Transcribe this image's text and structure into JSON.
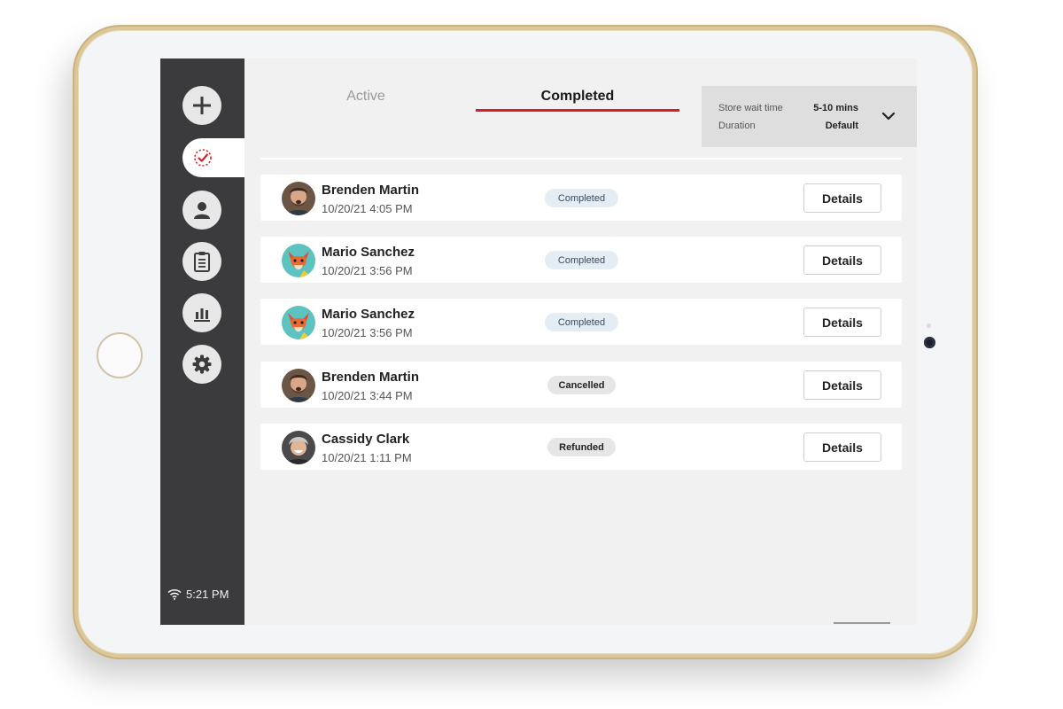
{
  "tabs": [
    {
      "label": "Active",
      "active": false
    },
    {
      "label": "Completed",
      "active": true
    }
  ],
  "wait_panel": {
    "store_wait_label": "Store wait time",
    "store_wait_value": "5-10 mins",
    "duration_label": "Duration",
    "duration_value": "Default"
  },
  "sidebar": {
    "items": [
      {
        "icon": "plus-icon",
        "active": false
      },
      {
        "icon": "check-timer-icon",
        "active": true
      },
      {
        "icon": "user-icon",
        "active": false
      },
      {
        "icon": "clipboard-icon",
        "active": false
      },
      {
        "icon": "bar-chart-icon",
        "active": false
      },
      {
        "icon": "gear-icon",
        "active": false
      }
    ],
    "status_time": "5:21 PM"
  },
  "orders": [
    {
      "name": "Brenden Martin",
      "time": "10/20/21 4:05 PM",
      "status": "Completed",
      "avatar": "man-avatar",
      "action": "Details"
    },
    {
      "name": "Mario Sanchez",
      "time": "10/20/21 3:56 PM",
      "status": "Completed",
      "avatar": "fox-avatar",
      "action": "Details"
    },
    {
      "name": "Mario Sanchez",
      "time": "10/20/21 3:56 PM",
      "status": "Completed",
      "avatar": "fox-avatar",
      "action": "Details"
    },
    {
      "name": "Brenden Martin",
      "time": "10/20/21 3:44 PM",
      "status": "Cancelled",
      "avatar": "man-avatar",
      "action": "Details"
    },
    {
      "name": "Cassidy Clark",
      "time": "10/20/21 1:11 PM",
      "status": "Refunded",
      "avatar": "woman-avatar",
      "action": "Details"
    }
  ],
  "colors": {
    "accent": "#d81f26",
    "sidebar": "#3b3b3e",
    "completed_badge": "#e4ecf4",
    "neutral_badge": "#e6e6e6"
  }
}
